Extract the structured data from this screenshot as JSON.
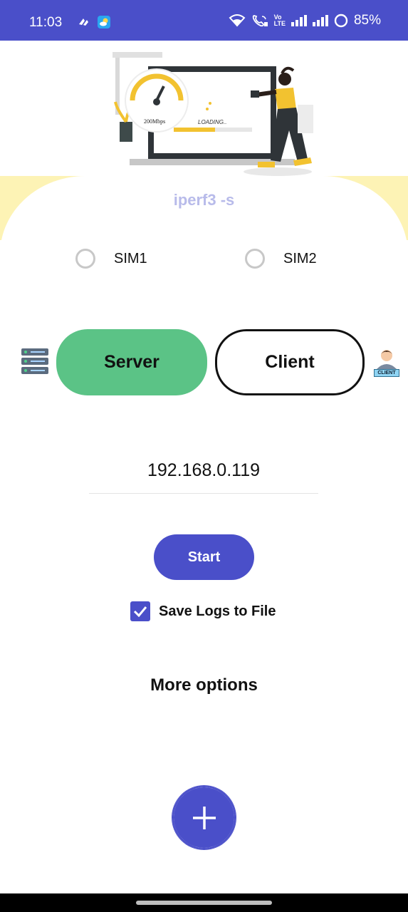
{
  "status_bar": {
    "time": "11:03",
    "battery": "85%",
    "volte_top": "Vo",
    "volte_bottom": "LTE",
    "bg_color": "#4a4fc9"
  },
  "hero": {
    "title": "iperf3 -s",
    "speed_label": "200Mbps",
    "loading_label": "LOADING.."
  },
  "sim": {
    "options": [
      {
        "label": "SIM1",
        "selected": false
      },
      {
        "label": "SIM2",
        "selected": false
      }
    ]
  },
  "mode": {
    "server_label": "Server",
    "client_label": "Client",
    "client_icon_text": "CLIENT",
    "server_color": "#5bc386"
  },
  "ip": {
    "value": "192.168.0.119"
  },
  "actions": {
    "start_label": "Start",
    "save_logs_label": "Save Logs to File",
    "save_logs_checked": true,
    "more_options_label": "More options",
    "accent_color": "#4a4fc9"
  },
  "icons": [
    "wifi-icon",
    "wifi-call-icon",
    "signal-icon",
    "battery-icon",
    "server-icon",
    "client-avatar-icon",
    "plus-icon",
    "check-icon",
    "speedometer-icon"
  ]
}
